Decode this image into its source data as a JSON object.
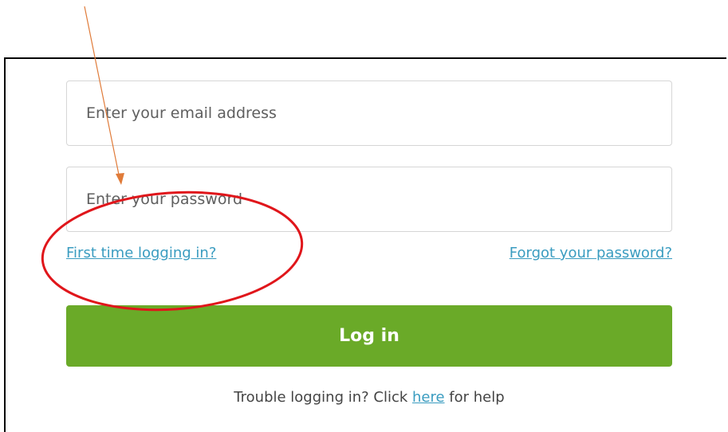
{
  "login_form": {
    "email_placeholder": "Enter your email address",
    "password_placeholder": "Enter your password",
    "first_time_link": "First time logging in?",
    "forgot_link": "Forgot your password?",
    "login_button": "Log in",
    "trouble_prefix": "Trouble logging in? Click ",
    "trouble_link": "here",
    "trouble_suffix": " for help"
  },
  "colors": {
    "link": "#3a9cc0",
    "button": "#6aaa28",
    "annotation_arrow": "#e07b39",
    "annotation_circle": "#e0161b"
  }
}
